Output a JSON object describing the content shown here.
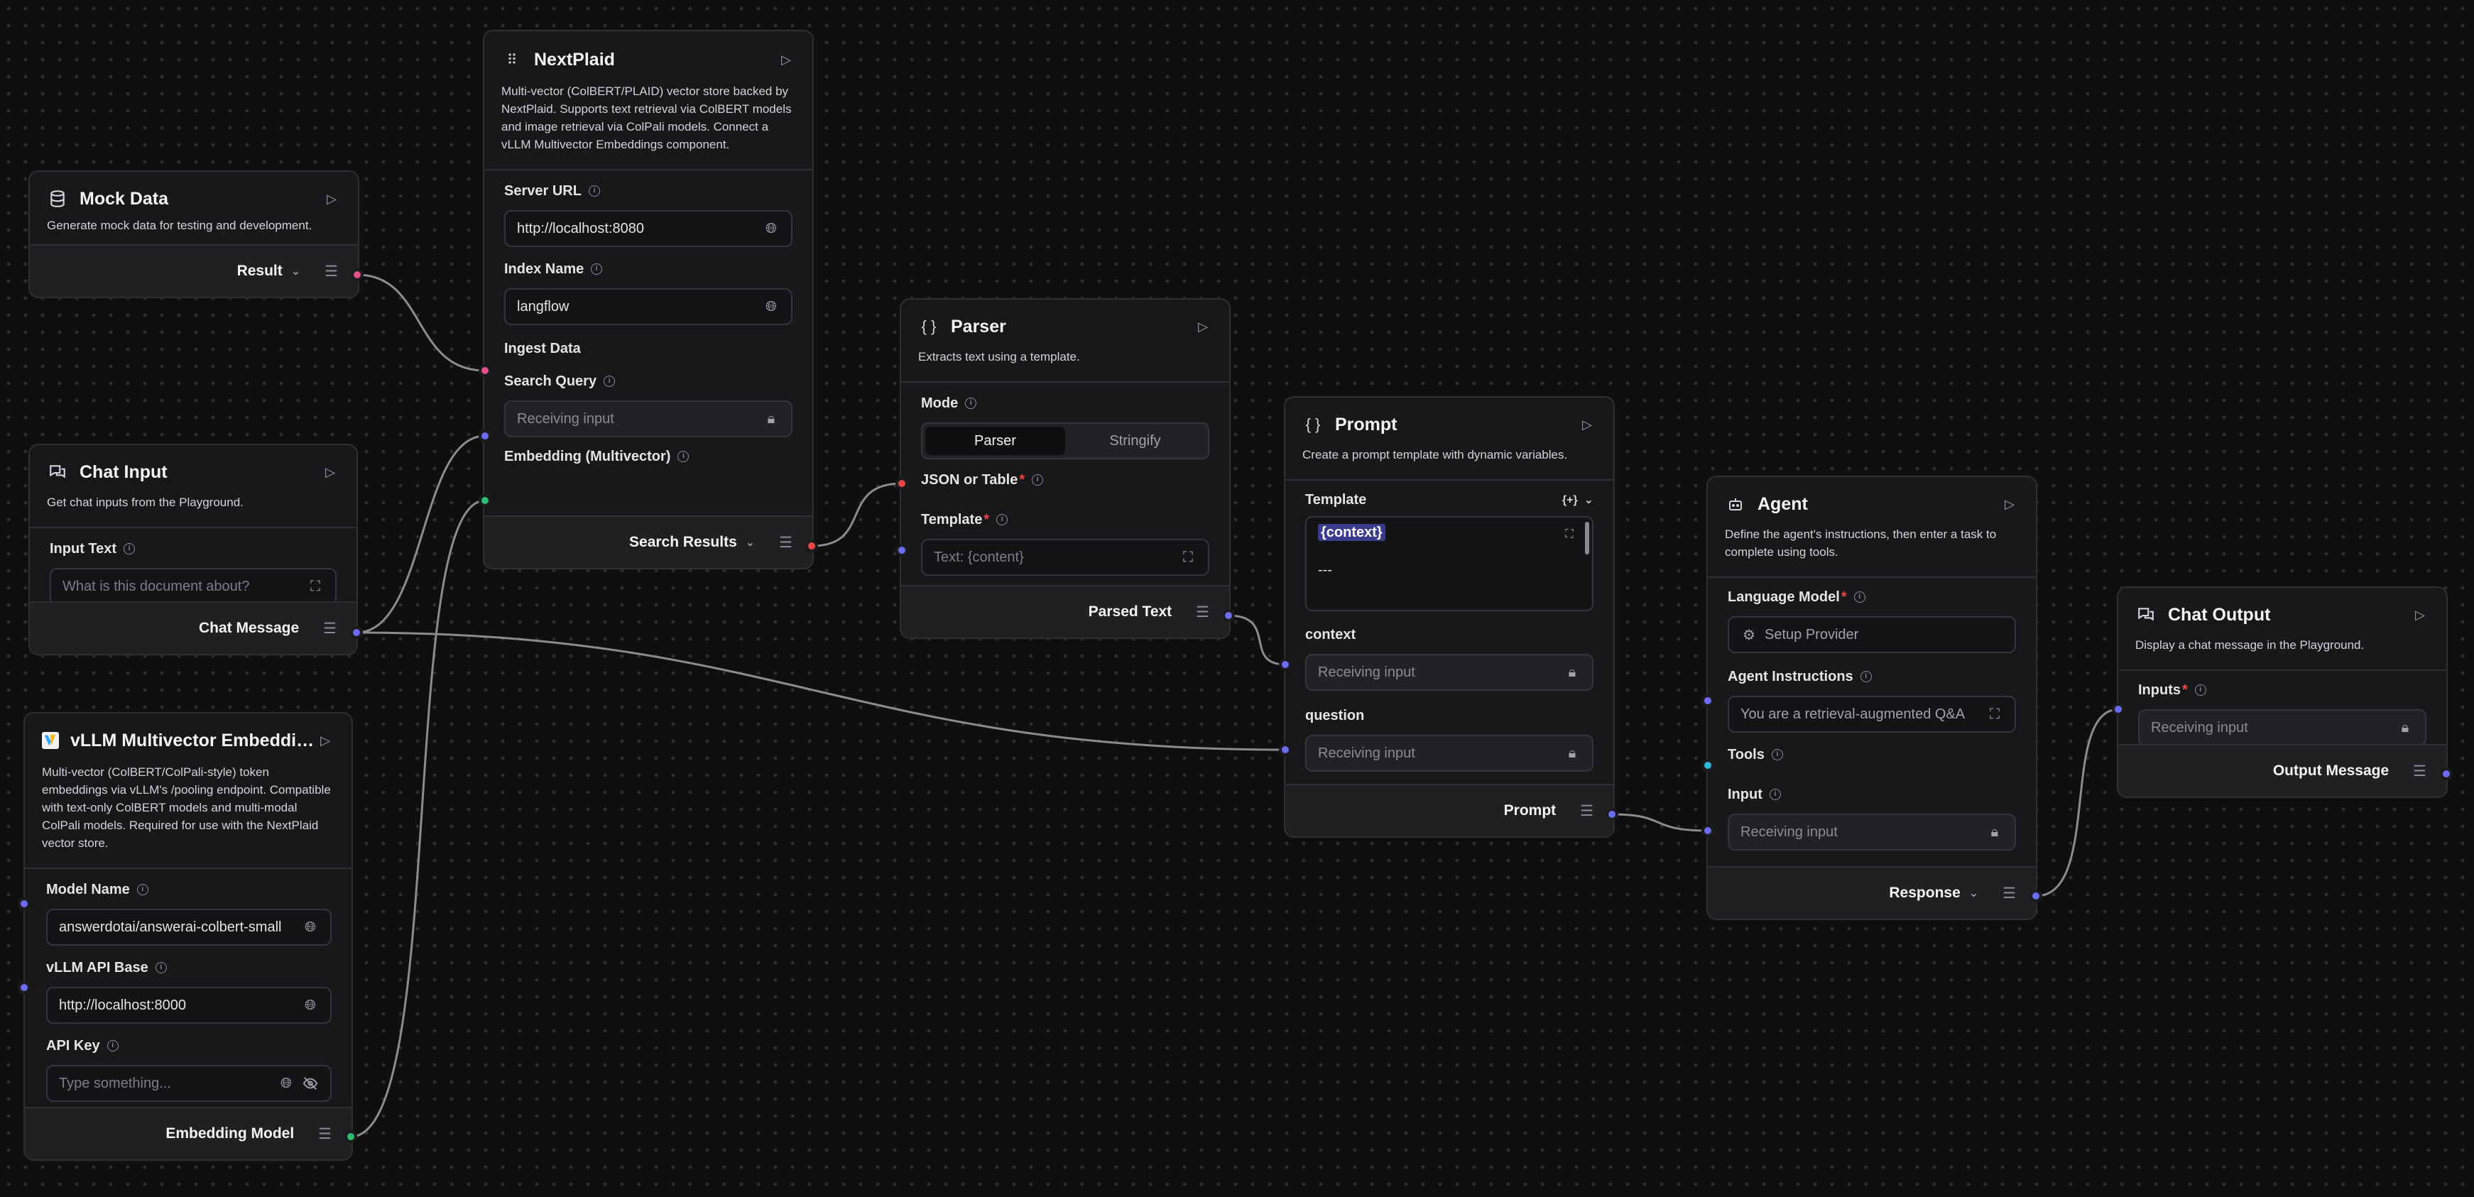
{
  "nodes": {
    "mock_data": {
      "title": "Mock Data",
      "description": "Generate mock data for testing and development.",
      "output": "Result"
    },
    "next_plaid": {
      "title": "NextPlaid",
      "description": "Multi-vector (ColBERT/PLAID) vector store backed by NextPlaid. Supports text retrieval via ColBERT models and image retrieval via ColPali models. Connect a vLLM Multivector Embeddings component.",
      "server_url_label": "Server URL",
      "server_url_value": "http://localhost:8080",
      "index_name_label": "Index Name",
      "index_name_value": "langflow",
      "ingest_data_label": "Ingest Data",
      "search_query_label": "Search Query",
      "search_query_value": "Receiving input",
      "embedding_label": "Embedding (Multivector)",
      "output": "Search Results"
    },
    "chat_input": {
      "title": "Chat Input",
      "description": "Get chat inputs from the Playground.",
      "input_text_label": "Input Text",
      "input_text_placeholder": "What is this document about?",
      "output": "Chat Message"
    },
    "vllm": {
      "title": "vLLM Multivector Embeddin...",
      "description": "Multi-vector (ColBERT/ColPali-style) token embeddings via vLLM's /pooling endpoint. Compatible with text-only ColBERT models and multi-modal ColPali models. Required for use with the NextPlaid vector store.",
      "model_name_label": "Model Name",
      "model_name_value": "answerdotai/answerai-colbert-small",
      "api_base_label": "vLLM API Base",
      "api_base_value": "http://localhost:8000",
      "api_key_label": "API Key",
      "api_key_placeholder": "Type something...",
      "output": "Embedding Model"
    },
    "parser": {
      "title": "Parser",
      "description": "Extracts text using a template.",
      "mode_label": "Mode",
      "mode_options": [
        "Parser",
        "Stringify"
      ],
      "json_label": "JSON or Table",
      "template_label": "Template",
      "template_placeholder": "Text: {content}",
      "output": "Parsed Text"
    },
    "prompt": {
      "title": "Prompt",
      "description": "Create a prompt template with dynamic variables.",
      "template_label": "Template",
      "template_tag": "{+}",
      "template_line1": "{context}",
      "template_line2": "---",
      "context_label": "context",
      "context_value": "Receiving input",
      "question_label": "question",
      "question_value": "Receiving input",
      "output": "Prompt"
    },
    "agent": {
      "title": "Agent",
      "description": "Define the agent's instructions, then enter a task to complete using tools.",
      "model_label": "Language Model",
      "model_value": "Setup Provider",
      "instructions_label": "Agent Instructions",
      "instructions_value": "You are a retrieval-augmented Q&A",
      "tools_label": "Tools",
      "input_label": "Input",
      "input_value": "Receiving input",
      "output": "Response"
    },
    "chat_output": {
      "title": "Chat Output",
      "description": "Display a chat message in the Playground.",
      "inputs_label": "Inputs",
      "inputs_value": "Receiving input",
      "output": "Output Message"
    }
  },
  "colors": {
    "canvas": "#0f0f10",
    "node": "#18181b",
    "handle_blue": "#6c6cf2",
    "handle_pink": "#e0508a",
    "handle_red": "#e64848",
    "handle_green": "#2ebd73",
    "handle_cyan": "#31b9d9",
    "edge": "#8b8b90"
  }
}
